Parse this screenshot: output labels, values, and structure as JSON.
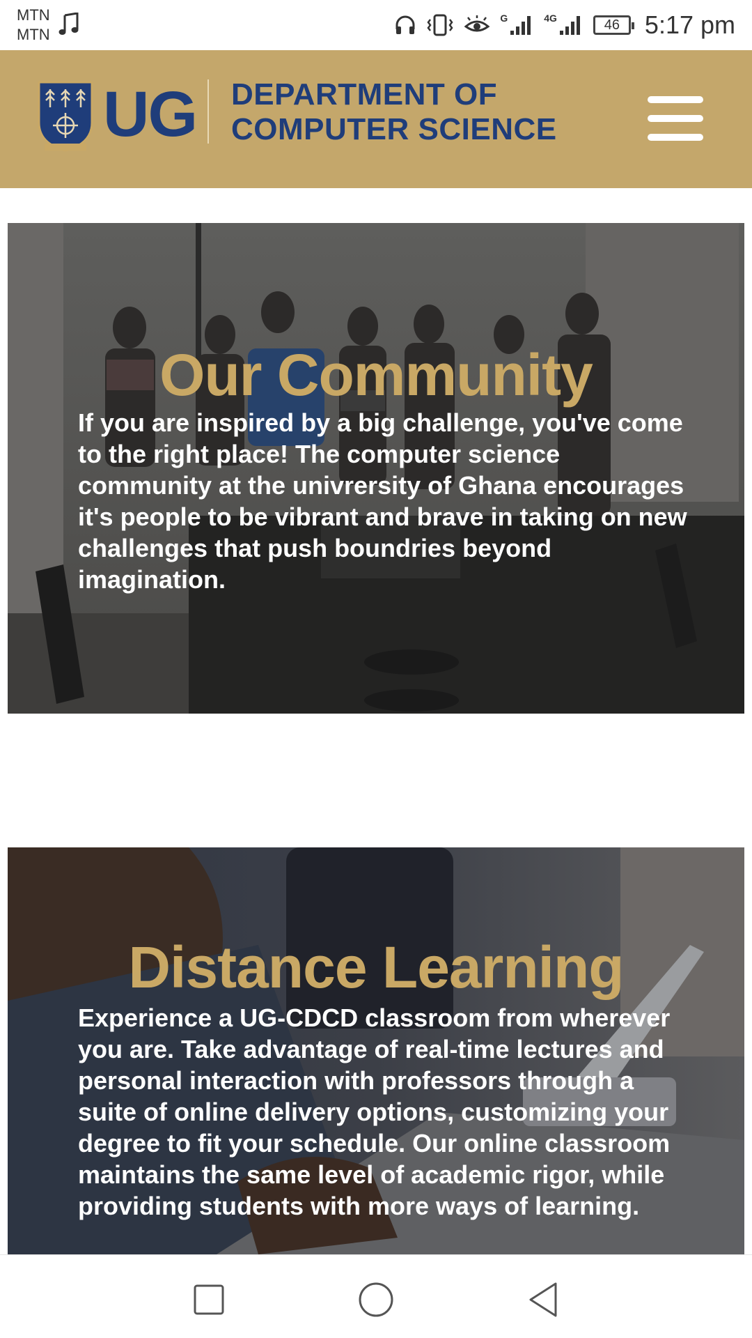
{
  "status_bar": {
    "carrier_1": "MTN",
    "carrier_2": "MTN",
    "network_1": "G",
    "network_2": "4G",
    "battery_level": "46",
    "time": "5:17 pm",
    "icons": [
      "music-note-icon",
      "headphones-icon",
      "vibrate-icon",
      "eye-comfort-icon",
      "signal-icon",
      "signal-icon",
      "battery-icon"
    ]
  },
  "header": {
    "logo_text": "UG",
    "department_line_1": "DEPARTMENT OF",
    "department_line_2": "COMPUTER SCIENCE",
    "menu_icon": "hamburger-menu-icon",
    "background_color": "#c4a76b",
    "text_color": "#1f3d7a"
  },
  "sections": [
    {
      "title": "Our Community",
      "body": "If you are inspired by a big challenge, you've come to the right place! The computer science community at the univrersity of Ghana encourages it's people to be vibrant and brave in taking on new challenges that push boundries beyond imagination."
    },
    {
      "title": "Distance Learning",
      "body": "Experience a UG-CDCD classroom from wherever you are. Take advantage of real-time lectures and personal interaction with professors through a suite of online delivery options, customizing your degree to fit your schedule. Our online classroom maintains the same level of academic rigor, while providing students with more ways of learning."
    }
  ],
  "colors": {
    "accent_gold": "#c9a865",
    "card_text": "#ffffff"
  },
  "nav_bar": {
    "icons": [
      "recents-square-icon",
      "home-circle-icon",
      "back-triangle-icon"
    ]
  }
}
